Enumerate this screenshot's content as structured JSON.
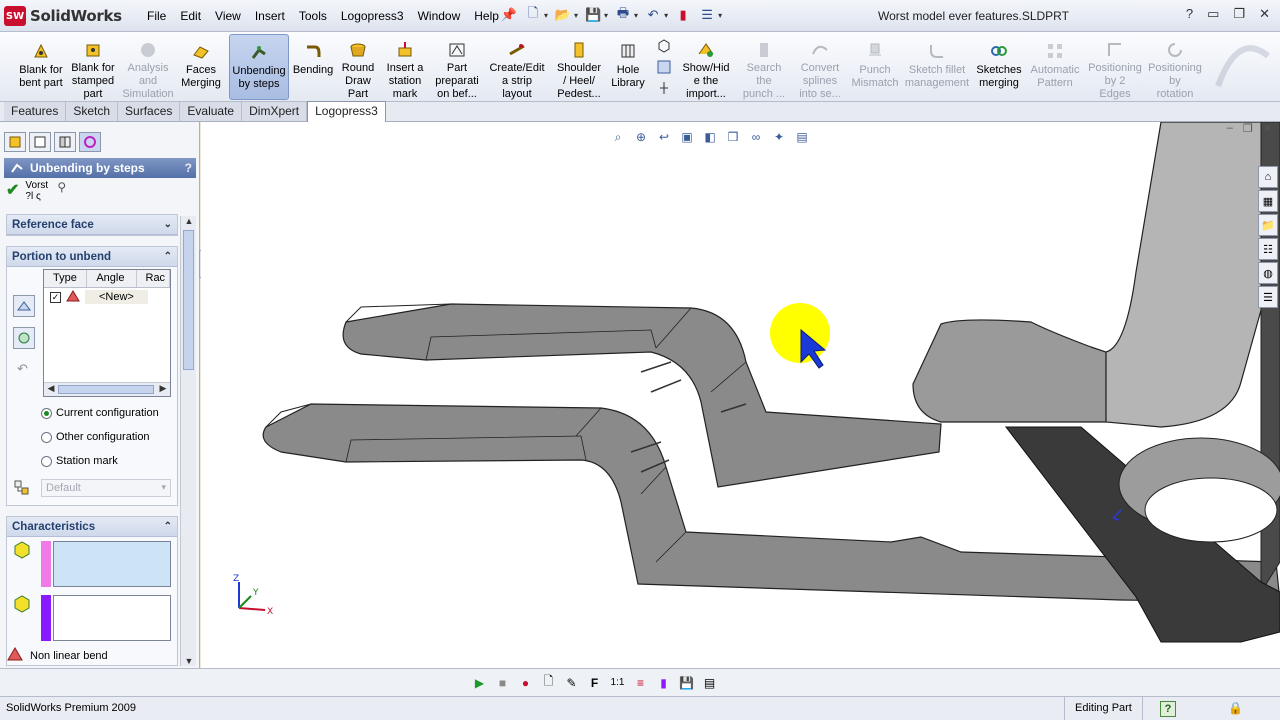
{
  "app": {
    "logo_badge": "SW",
    "logo_text": "SolidWorks",
    "document_title": "Worst model ever features.SLDPRT"
  },
  "menu": [
    "File",
    "Edit",
    "View",
    "Insert",
    "Tools",
    "Logopress3",
    "Window",
    "Help"
  ],
  "window_controls": {
    "help": "?",
    "minimize": "▭",
    "restore": "❐",
    "close": "✕"
  },
  "commands": [
    {
      "label": "Blank for\nbent part",
      "icon": "blank-bent-icon",
      "state": "enabled"
    },
    {
      "label": "Blank for\nstamped\npart",
      "icon": "blank-stamped-icon",
      "state": "enabled"
    },
    {
      "label": "Analysis\nand\nSimulation",
      "icon": "analysis-icon",
      "state": "disabled"
    },
    {
      "label": "Faces\nMerging",
      "icon": "faces-merging-icon",
      "state": "enabled"
    },
    {
      "label": "Unbending\nby steps",
      "icon": "unbending-icon",
      "state": "active"
    },
    {
      "label": "Bending",
      "icon": "bending-icon",
      "state": "enabled"
    },
    {
      "label": "Round\nDraw\nPart",
      "icon": "round-draw-icon",
      "state": "enabled"
    },
    {
      "label": "Insert a\nstation\nmark",
      "icon": "station-mark-icon",
      "state": "enabled"
    },
    {
      "label": "Part\npreparati\non bef...",
      "icon": "part-prep-icon",
      "state": "enabled"
    },
    {
      "label": "Create/Edit\na strip\nlayout",
      "icon": "strip-layout-icon",
      "state": "enabled"
    },
    {
      "label": "Shoulder\n/ Heel/\nPedest...",
      "icon": "shoulder-icon",
      "state": "enabled"
    },
    {
      "label": "Hole\nLibrary",
      "icon": "hole-library-icon",
      "state": "enabled"
    },
    {
      "label": "Show/Hid\ne the\nimport...",
      "icon": "show-hide-icon",
      "state": "enabled"
    },
    {
      "label": "Search\nthe\npunch ...",
      "icon": "search-punch-icon",
      "state": "disabled"
    },
    {
      "label": "Convert\nsplines\ninto se...",
      "icon": "convert-splines-icon",
      "state": "disabled"
    },
    {
      "label": "Punch\nMismatch",
      "icon": "punch-mismatch-icon",
      "state": "disabled"
    },
    {
      "label": "Sketch fillet\nmanagement",
      "icon": "sketch-fillet-icon",
      "state": "disabled"
    },
    {
      "label": "Sketches\nmerging",
      "icon": "sketches-merging-icon",
      "state": "enabled"
    },
    {
      "label": "Automatic\nPattern",
      "icon": "auto-pattern-icon",
      "state": "disabled"
    },
    {
      "label": "Positioning\nby 2\nEdges",
      "icon": "pos-edges-icon",
      "state": "disabled"
    },
    {
      "label": "Positioning\nby\nrotation",
      "icon": "pos-rotation-icon",
      "state": "disabled"
    }
  ],
  "tabs": [
    {
      "label": "Features",
      "active": false
    },
    {
      "label": "Sketch",
      "active": false
    },
    {
      "label": "Surfaces",
      "active": false
    },
    {
      "label": "Evaluate",
      "active": false
    },
    {
      "label": "DimXpert",
      "active": false
    },
    {
      "label": "Logopress3",
      "active": true
    }
  ],
  "property_manager": {
    "title": "Unbending by steps",
    "help": "?",
    "message_line1": "Vorst",
    "message_line2": "?l ς",
    "reference_face": "Reference face",
    "portion_to_unbend": "Portion to unbend",
    "list_columns": [
      "Type",
      "Angle",
      "Rac"
    ],
    "list_rows": [
      {
        "checked": true,
        "value": "<New>"
      }
    ],
    "options": [
      {
        "label": "Current configuration",
        "selected": true
      },
      {
        "label": "Other configuration",
        "selected": false
      },
      {
        "label": "Station mark",
        "selected": false
      }
    ],
    "config_select": "Default",
    "characteristics": "Characteristics",
    "swatch1_color": "#cde3f6",
    "swatch1_bar": "#f07be8",
    "swatch2_color": "#ffffff",
    "swatch2_bar": "#8a1aff",
    "non_linear_bend": "Non linear bend"
  },
  "viewport": {
    "triad_x": "X",
    "triad_y": "Y",
    "triad_z": "Z",
    "model_fill": "#8a8a8a",
    "highlight_color": "#ffff00"
  },
  "status": {
    "product": "SolidWorks Premium 2009",
    "mode": "Editing Part",
    "help": "?"
  }
}
